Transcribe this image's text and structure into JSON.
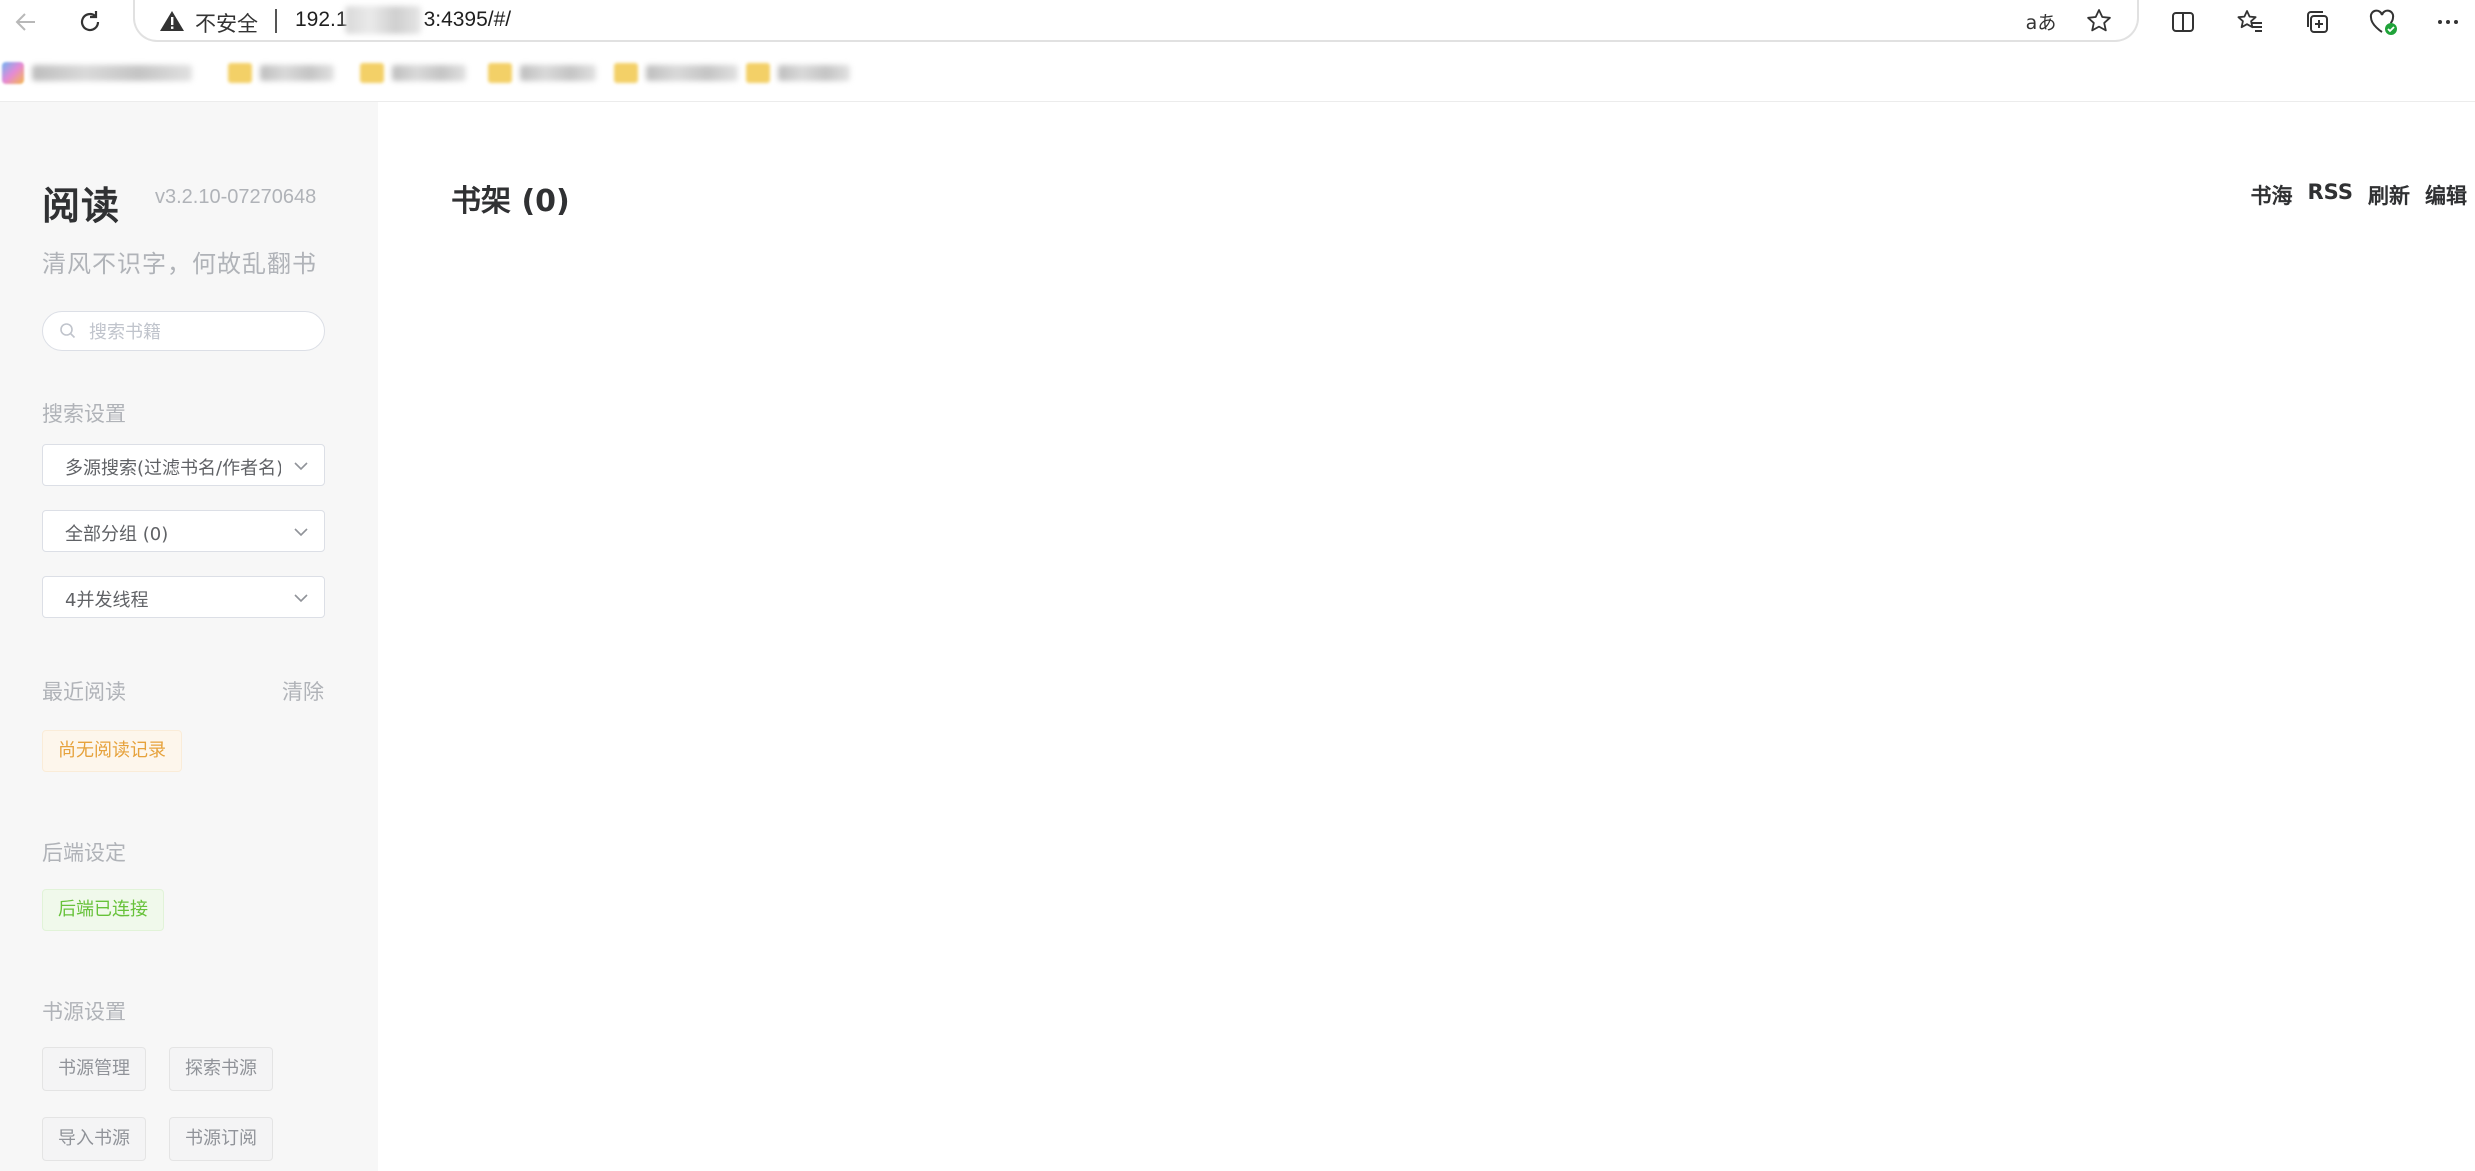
{
  "browser": {
    "security_label": "不安全",
    "url_prefix": "192.1",
    "url_suffix": "3:4395/#/",
    "read_aloud_label": "aあ"
  },
  "app": {
    "title": "阅读",
    "version": "v3.2.10-07270648",
    "slogan": "清风不识字，何故乱翻书"
  },
  "search": {
    "placeholder": "搜索书籍"
  },
  "search_settings": {
    "title": "搜索设置",
    "source_mode": "多源搜索(过滤书名/作者名)",
    "group": "全部分组 (0)",
    "threads": "4并发线程"
  },
  "recent": {
    "title": "最近阅读",
    "clear_label": "清除",
    "empty_label": "尚无阅读记录"
  },
  "backend": {
    "title": "后端设定",
    "status_label": "后端已连接"
  },
  "sources": {
    "title": "书源设置",
    "buttons": [
      "书源管理",
      "探索书源",
      "导入书源",
      "书源订阅"
    ]
  },
  "shelf": {
    "title": "书架 (0)",
    "actions": [
      "书海",
      "RSS",
      "刷新",
      "编辑"
    ]
  },
  "colors": {
    "sidebar_bg": "#f7f7f7",
    "warning": "#e6a23c",
    "success": "#67c23a",
    "text_primary": "#303133",
    "text_muted": "#b0b3b8"
  }
}
